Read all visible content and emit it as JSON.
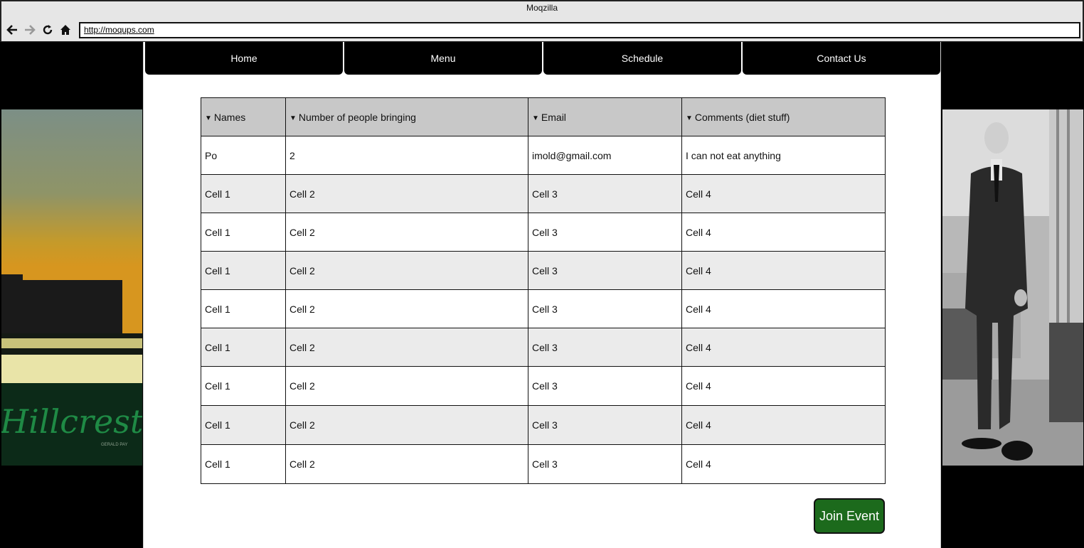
{
  "window": {
    "title": "Moqzilla"
  },
  "browser": {
    "url": "http://moqups.com",
    "nav_icons": [
      "back-arrow-icon",
      "forward-arrow-icon",
      "reload-icon",
      "home-icon"
    ]
  },
  "nav": {
    "tabs": [
      {
        "label": "Home"
      },
      {
        "label": "Menu"
      },
      {
        "label": "Schedule"
      },
      {
        "label": "Contact Us"
      }
    ]
  },
  "side_images": {
    "left": {
      "caption": "Hillcrest",
      "credit": "GERALD PAY"
    },
    "right": {
      "subject": "photo-man-in-suit"
    }
  },
  "table": {
    "headers": [
      "Names",
      "Number of people bringing",
      "Email",
      "Comments (diet stuff)"
    ],
    "sort_icon": "sort-down-triangle-icon",
    "rows": [
      [
        "Po",
        "2",
        "imold@gmail.com",
        "I can not eat anything"
      ],
      [
        "Cell 1",
        "Cell 2",
        "Cell 3",
        "Cell 4"
      ],
      [
        "Cell 1",
        "Cell 2",
        "Cell 3",
        "Cell 4"
      ],
      [
        "Cell 1",
        "Cell 2",
        "Cell 3",
        "Cell 4"
      ],
      [
        "Cell 1",
        "Cell 2",
        "Cell 3",
        "Cell 4"
      ],
      [
        "Cell 1",
        "Cell 2",
        "Cell 3",
        "Cell 4"
      ],
      [
        "Cell 1",
        "Cell 2",
        "Cell 3",
        "Cell 4"
      ],
      [
        "Cell 1",
        "Cell 2",
        "Cell 3",
        "Cell 4"
      ],
      [
        "Cell 1",
        "Cell 2",
        "Cell 3",
        "Cell 4"
      ]
    ]
  },
  "actions": {
    "join_label": "Join Event"
  },
  "colors": {
    "join_button": "#1c6a1c",
    "header_bg": "#c8c8c8",
    "stripe_bg": "#ebebeb"
  }
}
